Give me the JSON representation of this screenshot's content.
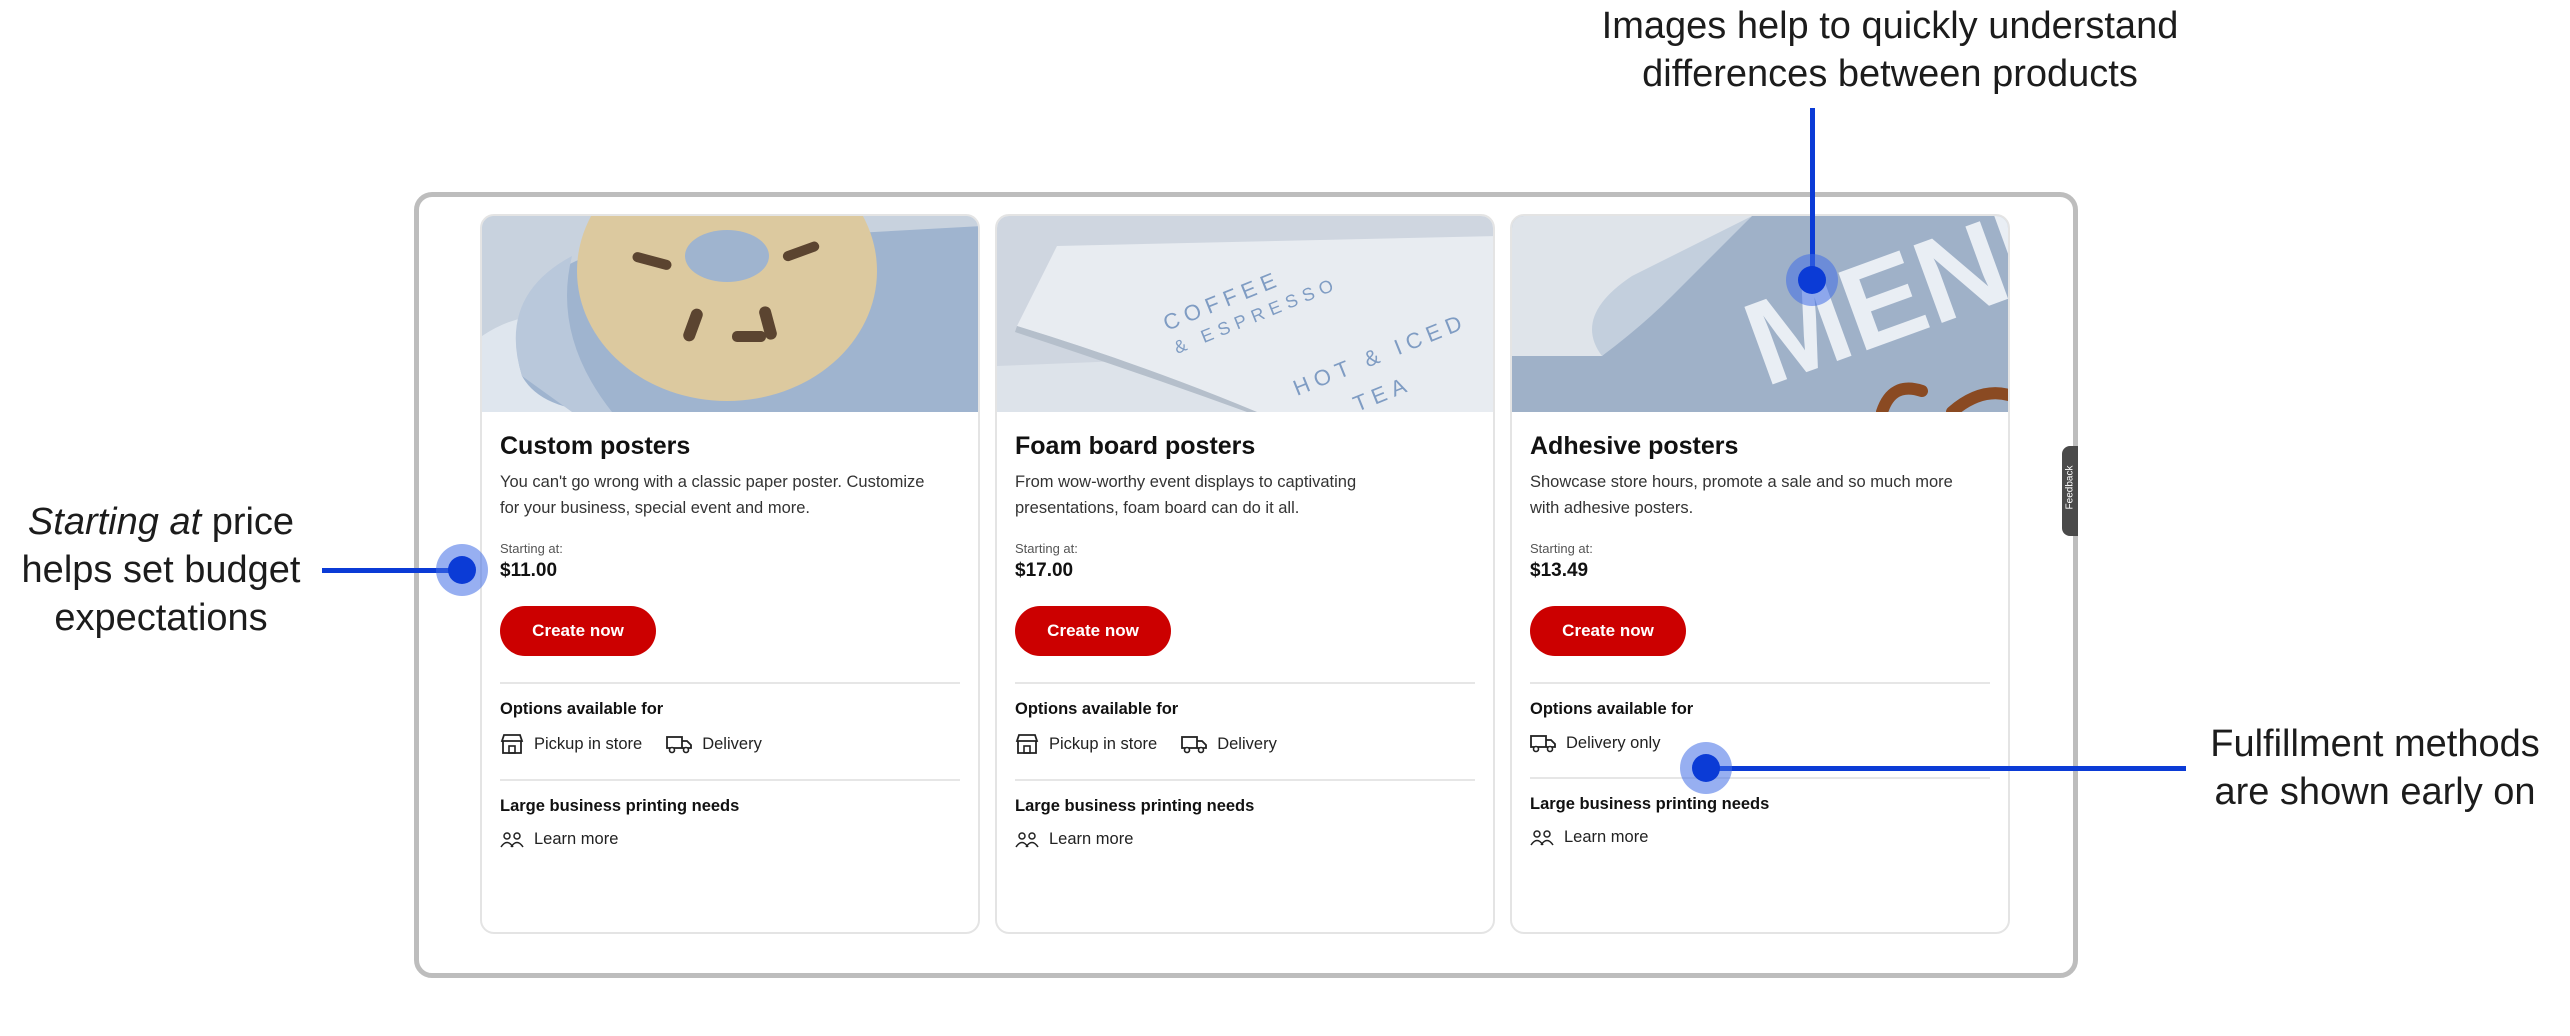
{
  "annotations": {
    "images": {
      "line1": "Images help to quickly understand",
      "line2": "differences between products"
    },
    "price": {
      "italic": "Starting at",
      "rest": " price",
      "line2": "helps set budget",
      "line3": "expectations"
    },
    "fulfillment": {
      "line1": "Fulfillment methods",
      "line2": "are shown early on"
    }
  },
  "feedback_tab": "Feedback",
  "colors": {
    "accent": "#cc0000",
    "annotation": "#0b3bd6",
    "frame": "#bdbdbd"
  },
  "cards": [
    {
      "title": "Custom posters",
      "desc_line1": "You can't go wrong with a classic paper poster. Customize",
      "desc_line2": "for your business, special event and more.",
      "starting_label": "Starting at:",
      "price": "$11.00",
      "cta": "Create now",
      "options_title": "Options available for",
      "option1": "Pickup in store",
      "option2": "Delivery",
      "business_title": "Large business printing needs",
      "learn_more": "Learn more"
    },
    {
      "title": "Foam board posters",
      "desc_line1": "From wow-worthy event displays to captivating",
      "desc_line2": "presentations, foam board can do it all.",
      "starting_label": "Starting at:",
      "price": "$17.00",
      "cta": "Create now",
      "options_title": "Options available for",
      "option1": "Pickup in store",
      "option2": "Delivery",
      "business_title": "Large business printing needs",
      "learn_more": "Learn more",
      "image_text": {
        "l1": "COFFEE",
        "l2": "& ESPRESSO",
        "l3": "HOT & ICED",
        "l4": "TEA"
      }
    },
    {
      "title": "Adhesive posters",
      "desc_line1": "Showcase store hours, promote a sale and so much more",
      "desc_line2": "with adhesive posters.",
      "starting_label": "Starting at:",
      "price": "$13.49",
      "cta": "Create now",
      "options_title": "Options available for",
      "option1": "Delivery only",
      "business_title": "Large business printing needs",
      "learn_more": "Learn more",
      "image_text": "MENU"
    }
  ]
}
